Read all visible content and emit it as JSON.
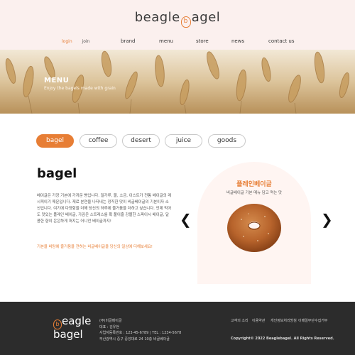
{
  "header": {
    "logo_text_1": "beagle",
    "logo_mark": "b",
    "logo_text_2": "agel",
    "login": "login",
    "join": "join",
    "nav": [
      "brand",
      "menu",
      "store",
      "news",
      "contact us"
    ]
  },
  "hero": {
    "title": "MENU",
    "subtitle": "Enjoy the bagels made with grain"
  },
  "tabs": [
    "bagel",
    "coffee",
    "desert",
    "juice",
    "goods"
  ],
  "active_tab": "bagel",
  "product": {
    "category_title": "bagel",
    "description": "베이글은 가장 기본에 가까운 빵입니다. 밀가루, 물, 소금, 이스트가 전통 베이글의 레시피이기 때문입니다. 재료 본연을 나타내는 정직한 맛이 비글베이글의 기본이자 소신입니다. 여기에 다양함을 더해 당신의 하루에 즐거움을 더하고 싶습니다. 언제 먹어도 맛있는 플레인 베이글, 가끔은 스트레스를 확 풀어줄 강렬한 스파이시 베이글, 달콤한 향이 은은하게 퍼지는 어니언 베이글까지!",
    "highlight": "기본을 바탕에 즐거움을 전하는 비글베이글을 당신의 일상에 더해보세요!",
    "featured_name": "플레인베이글",
    "featured_desc": "비글베이글 기본 메뉴 담고 먹는 맛",
    "prev_arrow": "❮",
    "next_arrow": "❯"
  },
  "footer": {
    "logo_line_1": "eagle",
    "logo_mark": "b",
    "logo_line_2": "agel",
    "company": "(주)비글베이글",
    "ceo": "대표 : 김유현",
    "biz": "사업자등록번호 : 123-45-6789  |  TEL : 1234-5678",
    "address": "부산광역시 중구 중앙대로 24 10층 비글베이글",
    "links": [
      "고객의 소리",
      "이용약관",
      "개인정보처리방침",
      "이메일무단수집거부"
    ],
    "copyright": "Copyright© 2022 Beaglebagel. All Rights Reserved."
  },
  "colors": {
    "accent": "#e77e35",
    "header_bg": "#fbf0ee",
    "footer_bg": "#2c2c2c",
    "arch_bg": "#fff5f2"
  }
}
